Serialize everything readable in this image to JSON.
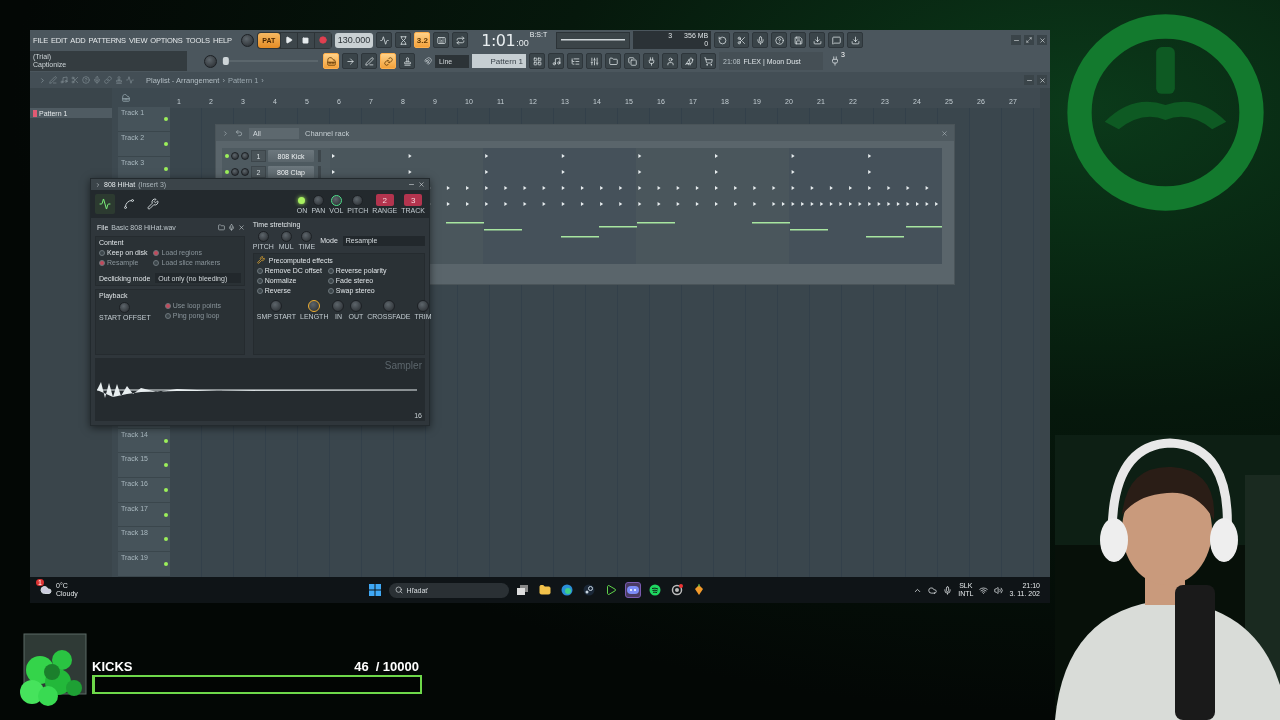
{
  "menu": [
    "FILE",
    "EDIT",
    "ADD",
    "PATTERNS",
    "VIEW",
    "OPTIONS",
    "TOOLS",
    "HELP"
  ],
  "hint_panel": {
    "line1": "(Trial)",
    "line2": "Captionize"
  },
  "transport": {
    "mode": "PAT",
    "tempo": "130.000",
    "time": "1:01",
    "ticks": ":00",
    "unit": "B:S:T"
  },
  "top_buttons": [
    {
      "kind": "metronome",
      "on": false
    },
    {
      "kind": "wait",
      "on": false
    },
    {
      "kind": "label",
      "label": "3.2",
      "on": true
    },
    {
      "kind": "typing",
      "on": false
    },
    {
      "kind": "loop",
      "on": false
    }
  ],
  "monitor": {
    "voices": "3",
    "memory": "356 MB",
    "value": "0"
  },
  "app_buttons": [
    {
      "kind": "undo"
    },
    {
      "kind": "cut"
    },
    {
      "kind": "mic"
    },
    {
      "kind": "help"
    },
    {
      "kind": "save"
    },
    {
      "kind": "render"
    },
    {
      "kind": "chat"
    },
    {
      "kind": "download"
    }
  ],
  "tool_buttons": [
    {
      "kind": "piano",
      "on": true
    },
    {
      "kind": "arrow",
      "on": false
    },
    {
      "kind": "pen",
      "on": false
    },
    {
      "kind": "link",
      "on": true
    },
    {
      "kind": "stamp",
      "on": false
    }
  ],
  "snap": "Line",
  "pattern_picker": "Pattern 1",
  "view_buttons": [
    {
      "kind": "playlist"
    },
    {
      "kind": "pianoroll"
    },
    {
      "kind": "rack"
    },
    {
      "kind": "mixer"
    },
    {
      "kind": "browser"
    },
    {
      "kind": "files"
    },
    {
      "kind": "plugin"
    },
    {
      "kind": "person"
    },
    {
      "kind": "bird"
    },
    {
      "kind": "cart"
    }
  ],
  "news": {
    "time": "21:08",
    "text": "FLEX | Moon Dust",
    "badge": "3"
  },
  "pitch_slider": {
    "level": 0.02
  },
  "playlist": {
    "breadcrumb": [
      {
        "kind": "title",
        "text": "Playlist - Arrangement"
      },
      {
        "kind": "separator",
        "text": "›"
      },
      {
        "kind": "link",
        "text": "Pattern 1"
      },
      {
        "kind": "separator",
        "text": "›"
      }
    ],
    "patterns": [
      {
        "label": "Pattern 1",
        "selected": true
      }
    ],
    "ruler": [
      "1",
      "2",
      "3",
      "4",
      "5",
      "6",
      "7",
      "8",
      "9",
      "10",
      "11",
      "12",
      "13",
      "14",
      "15",
      "16",
      "17",
      "18",
      "19",
      "20",
      "21",
      "22",
      "23",
      "24",
      "25",
      "26",
      "27"
    ],
    "tracks_top": [
      {
        "label": "Track 1"
      },
      {
        "label": "Track 2"
      },
      {
        "label": "Track 3"
      }
    ],
    "tracks_bottom": [
      {
        "label": "Track 14"
      },
      {
        "label": "Track 15"
      },
      {
        "label": "Track 16"
      },
      {
        "label": "Track 17"
      },
      {
        "label": "Track 18"
      },
      {
        "label": "Track 19"
      }
    ]
  },
  "channel_rack": {
    "filter": "All",
    "title": "Channel rack",
    "channels": [
      {
        "number": "1",
        "name": "808 Kick"
      },
      {
        "number": "2",
        "name": "808 Clap"
      }
    ]
  },
  "sampler": {
    "title": "808 HiHat",
    "insert": "(Insert 3)",
    "tabs": [
      {
        "kind": "wave",
        "selected": true
      },
      {
        "kind": "envelope",
        "selected": false
      },
      {
        "kind": "wrench",
        "selected": false
      }
    ],
    "controls": [
      {
        "kind": "led",
        "label": "ON"
      },
      {
        "kind": "knob",
        "label": "PAN"
      },
      {
        "kind": "knob_active",
        "label": "VOL"
      },
      {
        "kind": "knob",
        "label": "PITCH"
      },
      {
        "kind": "number",
        "label": "RANGE",
        "value": "2"
      },
      {
        "kind": "number",
        "label": "TRACK",
        "value": "3"
      }
    ],
    "file_label": "File",
    "file_name": "Basic 808 HiHat.wav",
    "content_title": "Content",
    "content_options": [
      {
        "label": "Keep on disk",
        "checked": false,
        "disabled": false
      },
      {
        "label": "Load regions",
        "checked": true,
        "disabled": true
      },
      {
        "label": "Resample",
        "checked": true,
        "disabled": true
      },
      {
        "label": "Load slice markers",
        "checked": false,
        "disabled": true
      }
    ],
    "declick_label": "Declicking mode",
    "declick_value": "Out only (no bleeding)",
    "playback_title": "Playback",
    "playback_knob": "START OFFSET",
    "playback_options": [
      {
        "label": "Use loop points",
        "checked": true,
        "disabled": true
      },
      {
        "label": "Ping pong loop",
        "checked": false,
        "disabled": true
      }
    ],
    "stretch_title": "Time stretching",
    "stretch_knobs": [
      "PITCH",
      "MUL",
      "TIME"
    ],
    "mode_label": "Mode",
    "mode_value": "Resample",
    "effects_title": "Precomputed effects",
    "effects": [
      {
        "label": "Remove DC offset",
        "checked": false
      },
      {
        "label": "Reverse polarity",
        "checked": false
      },
      {
        "label": "Normalize",
        "checked": false
      },
      {
        "label": "Fade stereo",
        "checked": false
      },
      {
        "label": "Reverse",
        "checked": false
      },
      {
        "label": "Swap stereo",
        "checked": false
      }
    ],
    "effect_knobs": [
      {
        "label": "SMP START",
        "active": false
      },
      {
        "label": "LENGTH",
        "active": true
      },
      {
        "label": "IN",
        "active": false
      },
      {
        "label": "OUT",
        "active": false
      },
      {
        "label": "CROSSFADE",
        "active": false
      },
      {
        "label": "TRIM",
        "active": false
      }
    ],
    "wave_label": "Sampler",
    "wave_zoom": "16"
  },
  "taskbar": {
    "weather": {
      "temp": "0°C",
      "text": "Cloudy",
      "badge": "1"
    },
    "search_placeholder": "Hľadať",
    "apps": [
      {
        "kind": "windows",
        "selected": false
      },
      {
        "kind": "taskview",
        "selected": false
      },
      {
        "kind": "folder",
        "selected": false
      },
      {
        "kind": "edge",
        "selected": false
      },
      {
        "kind": "steam",
        "selected": false
      },
      {
        "kind": "play",
        "selected": false
      },
      {
        "kind": "discord",
        "selected": true
      },
      {
        "kind": "spotify",
        "selected": false
      },
      {
        "kind": "chrome",
        "selected": false
      },
      {
        "kind": "fl",
        "selected": false
      }
    ],
    "language": "SLK",
    "layout": "INTL",
    "time": "21:10",
    "date": "3. 11. 202"
  },
  "goal": {
    "title": "KICKS",
    "count": "46",
    "target": "/ 10000",
    "level": 0.0046
  }
}
